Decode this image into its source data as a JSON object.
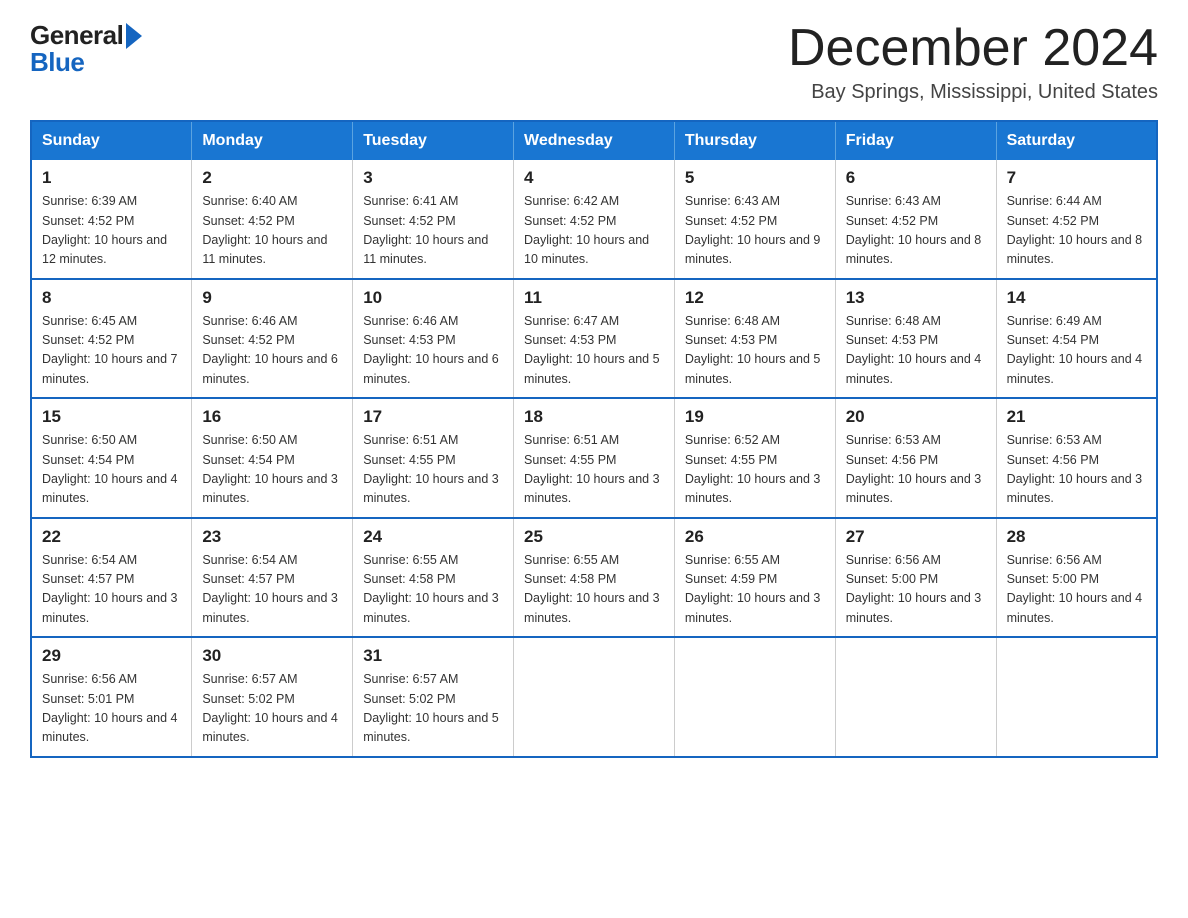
{
  "logo": {
    "text_general": "General",
    "text_blue": "Blue",
    "alt": "GeneralBlue logo"
  },
  "header": {
    "month": "December 2024",
    "location": "Bay Springs, Mississippi, United States"
  },
  "weekdays": [
    "Sunday",
    "Monday",
    "Tuesday",
    "Wednesday",
    "Thursday",
    "Friday",
    "Saturday"
  ],
  "weeks": [
    [
      {
        "day": "1",
        "sunrise": "Sunrise: 6:39 AM",
        "sunset": "Sunset: 4:52 PM",
        "daylight": "Daylight: 10 hours and 12 minutes."
      },
      {
        "day": "2",
        "sunrise": "Sunrise: 6:40 AM",
        "sunset": "Sunset: 4:52 PM",
        "daylight": "Daylight: 10 hours and 11 minutes."
      },
      {
        "day": "3",
        "sunrise": "Sunrise: 6:41 AM",
        "sunset": "Sunset: 4:52 PM",
        "daylight": "Daylight: 10 hours and 11 minutes."
      },
      {
        "day": "4",
        "sunrise": "Sunrise: 6:42 AM",
        "sunset": "Sunset: 4:52 PM",
        "daylight": "Daylight: 10 hours and 10 minutes."
      },
      {
        "day": "5",
        "sunrise": "Sunrise: 6:43 AM",
        "sunset": "Sunset: 4:52 PM",
        "daylight": "Daylight: 10 hours and 9 minutes."
      },
      {
        "day": "6",
        "sunrise": "Sunrise: 6:43 AM",
        "sunset": "Sunset: 4:52 PM",
        "daylight": "Daylight: 10 hours and 8 minutes."
      },
      {
        "day": "7",
        "sunrise": "Sunrise: 6:44 AM",
        "sunset": "Sunset: 4:52 PM",
        "daylight": "Daylight: 10 hours and 8 minutes."
      }
    ],
    [
      {
        "day": "8",
        "sunrise": "Sunrise: 6:45 AM",
        "sunset": "Sunset: 4:52 PM",
        "daylight": "Daylight: 10 hours and 7 minutes."
      },
      {
        "day": "9",
        "sunrise": "Sunrise: 6:46 AM",
        "sunset": "Sunset: 4:52 PM",
        "daylight": "Daylight: 10 hours and 6 minutes."
      },
      {
        "day": "10",
        "sunrise": "Sunrise: 6:46 AM",
        "sunset": "Sunset: 4:53 PM",
        "daylight": "Daylight: 10 hours and 6 minutes."
      },
      {
        "day": "11",
        "sunrise": "Sunrise: 6:47 AM",
        "sunset": "Sunset: 4:53 PM",
        "daylight": "Daylight: 10 hours and 5 minutes."
      },
      {
        "day": "12",
        "sunrise": "Sunrise: 6:48 AM",
        "sunset": "Sunset: 4:53 PM",
        "daylight": "Daylight: 10 hours and 5 minutes."
      },
      {
        "day": "13",
        "sunrise": "Sunrise: 6:48 AM",
        "sunset": "Sunset: 4:53 PM",
        "daylight": "Daylight: 10 hours and 4 minutes."
      },
      {
        "day": "14",
        "sunrise": "Sunrise: 6:49 AM",
        "sunset": "Sunset: 4:54 PM",
        "daylight": "Daylight: 10 hours and 4 minutes."
      }
    ],
    [
      {
        "day": "15",
        "sunrise": "Sunrise: 6:50 AM",
        "sunset": "Sunset: 4:54 PM",
        "daylight": "Daylight: 10 hours and 4 minutes."
      },
      {
        "day": "16",
        "sunrise": "Sunrise: 6:50 AM",
        "sunset": "Sunset: 4:54 PM",
        "daylight": "Daylight: 10 hours and 3 minutes."
      },
      {
        "day": "17",
        "sunrise": "Sunrise: 6:51 AM",
        "sunset": "Sunset: 4:55 PM",
        "daylight": "Daylight: 10 hours and 3 minutes."
      },
      {
        "day": "18",
        "sunrise": "Sunrise: 6:51 AM",
        "sunset": "Sunset: 4:55 PM",
        "daylight": "Daylight: 10 hours and 3 minutes."
      },
      {
        "day": "19",
        "sunrise": "Sunrise: 6:52 AM",
        "sunset": "Sunset: 4:55 PM",
        "daylight": "Daylight: 10 hours and 3 minutes."
      },
      {
        "day": "20",
        "sunrise": "Sunrise: 6:53 AM",
        "sunset": "Sunset: 4:56 PM",
        "daylight": "Daylight: 10 hours and 3 minutes."
      },
      {
        "day": "21",
        "sunrise": "Sunrise: 6:53 AM",
        "sunset": "Sunset: 4:56 PM",
        "daylight": "Daylight: 10 hours and 3 minutes."
      }
    ],
    [
      {
        "day": "22",
        "sunrise": "Sunrise: 6:54 AM",
        "sunset": "Sunset: 4:57 PM",
        "daylight": "Daylight: 10 hours and 3 minutes."
      },
      {
        "day": "23",
        "sunrise": "Sunrise: 6:54 AM",
        "sunset": "Sunset: 4:57 PM",
        "daylight": "Daylight: 10 hours and 3 minutes."
      },
      {
        "day": "24",
        "sunrise": "Sunrise: 6:55 AM",
        "sunset": "Sunset: 4:58 PM",
        "daylight": "Daylight: 10 hours and 3 minutes."
      },
      {
        "day": "25",
        "sunrise": "Sunrise: 6:55 AM",
        "sunset": "Sunset: 4:58 PM",
        "daylight": "Daylight: 10 hours and 3 minutes."
      },
      {
        "day": "26",
        "sunrise": "Sunrise: 6:55 AM",
        "sunset": "Sunset: 4:59 PM",
        "daylight": "Daylight: 10 hours and 3 minutes."
      },
      {
        "day": "27",
        "sunrise": "Sunrise: 6:56 AM",
        "sunset": "Sunset: 5:00 PM",
        "daylight": "Daylight: 10 hours and 3 minutes."
      },
      {
        "day": "28",
        "sunrise": "Sunrise: 6:56 AM",
        "sunset": "Sunset: 5:00 PM",
        "daylight": "Daylight: 10 hours and 4 minutes."
      }
    ],
    [
      {
        "day": "29",
        "sunrise": "Sunrise: 6:56 AM",
        "sunset": "Sunset: 5:01 PM",
        "daylight": "Daylight: 10 hours and 4 minutes."
      },
      {
        "day": "30",
        "sunrise": "Sunrise: 6:57 AM",
        "sunset": "Sunset: 5:02 PM",
        "daylight": "Daylight: 10 hours and 4 minutes."
      },
      {
        "day": "31",
        "sunrise": "Sunrise: 6:57 AM",
        "sunset": "Sunset: 5:02 PM",
        "daylight": "Daylight: 10 hours and 5 minutes."
      },
      null,
      null,
      null,
      null
    ]
  ]
}
